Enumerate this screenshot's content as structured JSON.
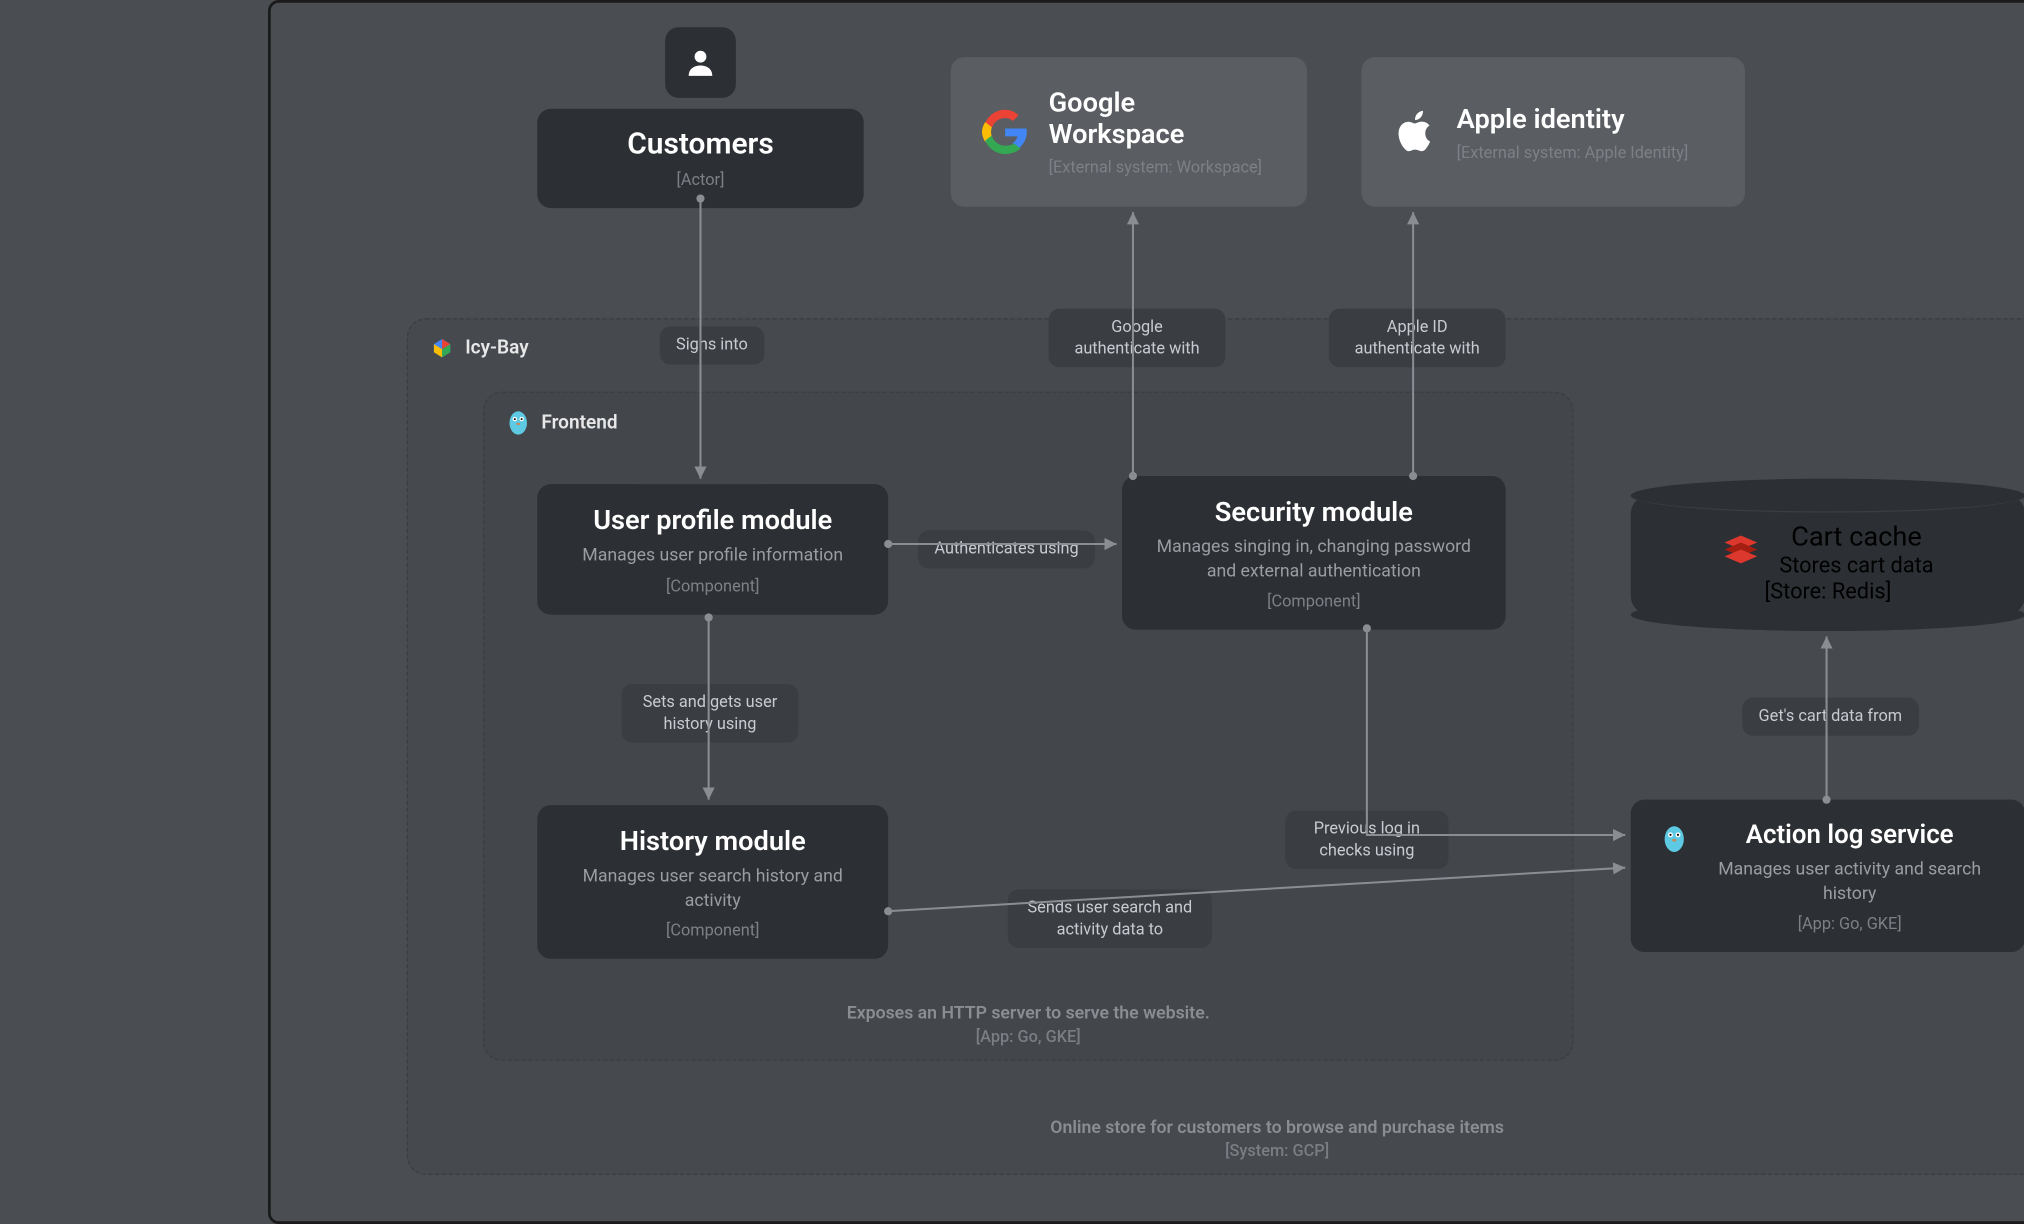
{
  "actor": {
    "title": "Customers",
    "meta": "[Actor]"
  },
  "external": {
    "google": {
      "title": "Google Workspace",
      "meta": "[External system: Workspace]"
    },
    "apple": {
      "title": "Apple identity",
      "meta": "[External system: Apple Identity]"
    }
  },
  "system": {
    "name": "Icy-Bay",
    "footer_desc": "Online store for customers to browse and purchase items",
    "footer_meta": "[System: GCP]"
  },
  "frontend": {
    "name": "Frontend",
    "footer_desc": "Exposes an HTTP server to serve the website.",
    "footer_meta": "[App: Go, GKE]"
  },
  "components": {
    "user_profile": {
      "title": "User profile module",
      "desc": "Manages user profile information",
      "meta": "[Component]"
    },
    "security": {
      "title": "Security module",
      "desc": "Manages singing in, changing password and external authentication",
      "meta": "[Component]"
    },
    "history": {
      "title": "History module",
      "desc": "Manages user search history and activity",
      "meta": "[Component]"
    }
  },
  "services": {
    "action_log": {
      "title": "Action log service",
      "desc": "Manages user activity and search history",
      "meta": "[App: Go, GKE]"
    }
  },
  "stores": {
    "cart_cache": {
      "title": "Cart cache",
      "desc": "Stores cart data",
      "meta": "[Store: Redis]"
    }
  },
  "edges": {
    "signs_into": "Signs into",
    "authenticates_using": "Authenticates using",
    "google_auth": "Google authenticate with",
    "apple_auth": "Apple ID authenticate with",
    "sets_gets_history": "Sets and gets user history using",
    "sends_search_activity": "Sends user search and activity data to",
    "prev_login_checks": "Previous log in checks using",
    "gets_cart_data": "Get's cart data from"
  }
}
